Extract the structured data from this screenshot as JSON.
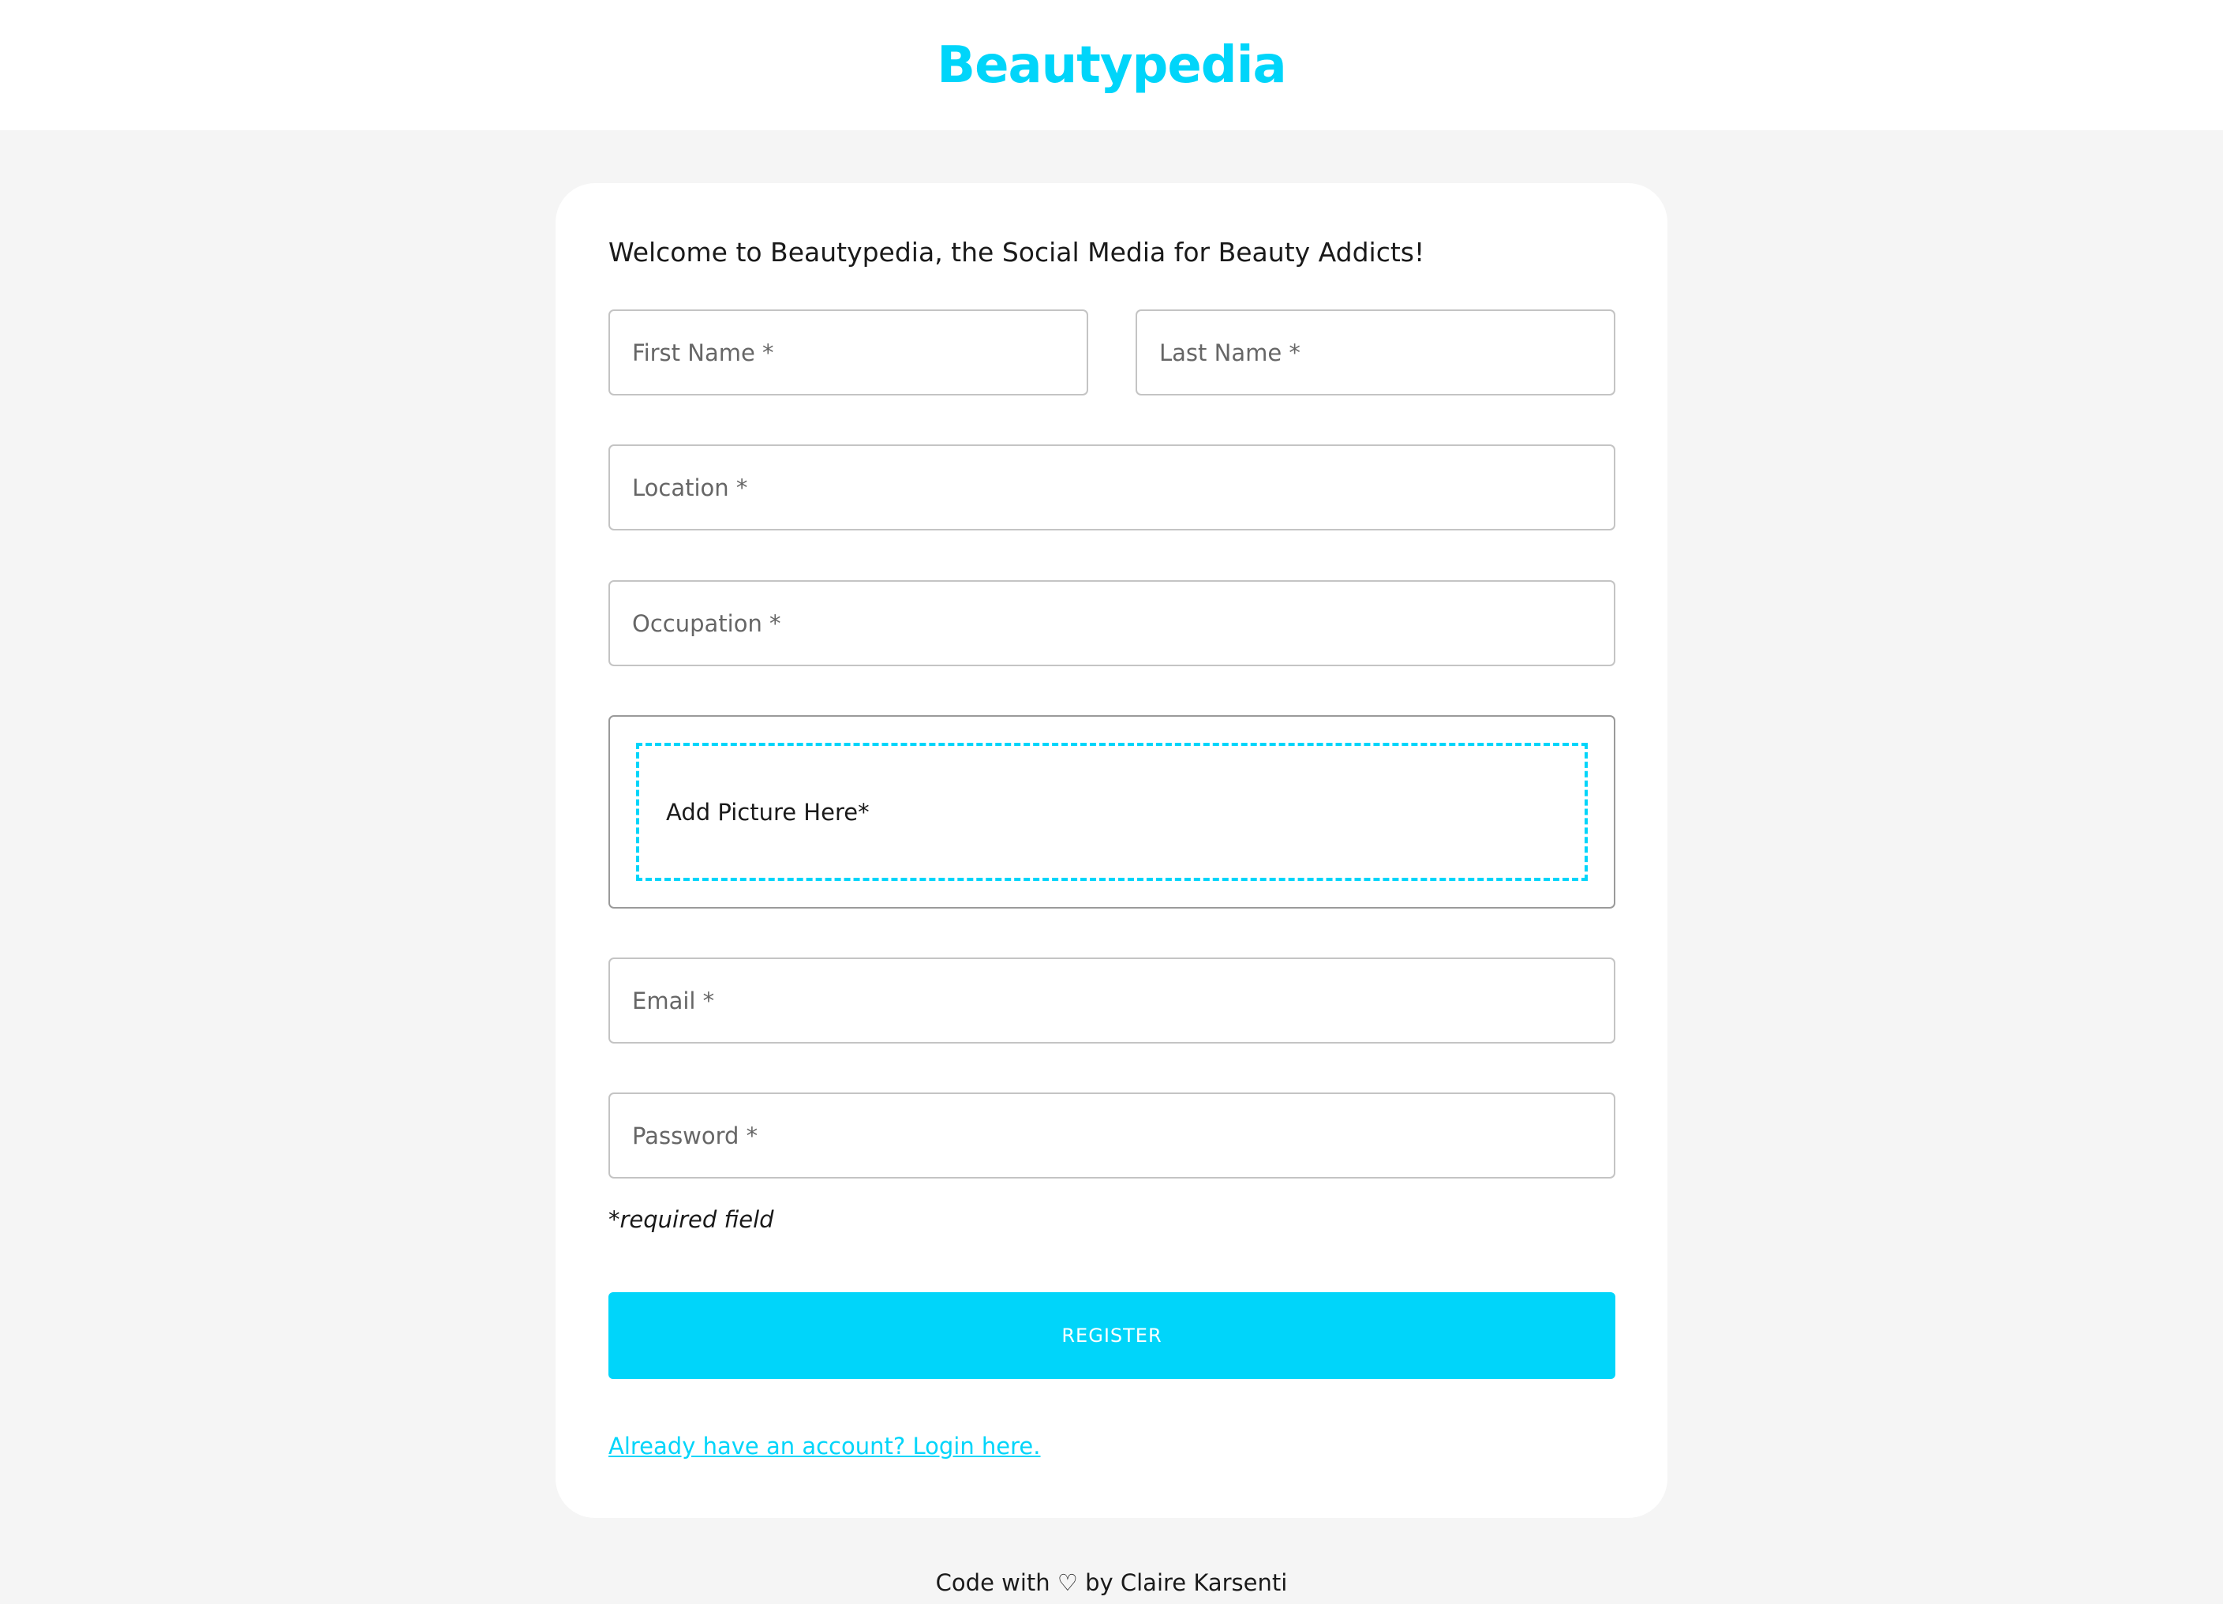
{
  "header": {
    "brand": "Beautypedia"
  },
  "form": {
    "welcome": "Welcome to Beautypedia, the Social Media for Beauty Addicts!",
    "first_name": {
      "placeholder": "First Name *",
      "value": ""
    },
    "last_name": {
      "placeholder": "Last Name *",
      "value": ""
    },
    "location": {
      "placeholder": "Location *",
      "value": ""
    },
    "occupation": {
      "placeholder": "Occupation *",
      "value": ""
    },
    "picture": {
      "label": "Add Picture Here*"
    },
    "email": {
      "placeholder": "Email *",
      "value": ""
    },
    "password": {
      "placeholder": "Password *",
      "value": ""
    },
    "required_note": "*required field",
    "register_label": "REGISTER",
    "login_link": "Already have an account? Login here."
  },
  "footer": {
    "text": "Code with ♡ by Claire Karsenti"
  },
  "colors": {
    "accent": "#00d5fa",
    "background": "#f5f5f5",
    "card": "#ffffff"
  }
}
